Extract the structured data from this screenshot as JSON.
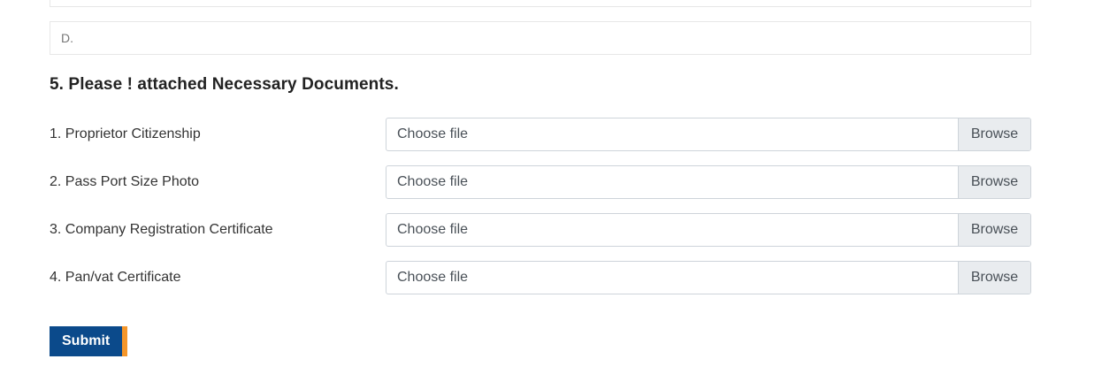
{
  "option_d": {
    "label": "D."
  },
  "documents_section": {
    "title": "5. Please ! attached Necessary Documents.",
    "rows": [
      {
        "label": "1. Proprietor Citizenship",
        "placeholder": "Choose file",
        "browse": "Browse"
      },
      {
        "label": "2. Pass Port Size Photo",
        "placeholder": "Choose file",
        "browse": "Browse"
      },
      {
        "label": "3. Company Registration Certificate",
        "placeholder": "Choose file",
        "browse": "Browse"
      },
      {
        "label": "4. Pan/vat Certificate",
        "placeholder": "Choose file",
        "browse": "Browse"
      }
    ]
  },
  "submit": {
    "label": "Submit"
  },
  "colors": {
    "submit_bg": "#0b4a8b",
    "submit_accent": "#f5962a",
    "browse_bg": "#e9ecef"
  }
}
